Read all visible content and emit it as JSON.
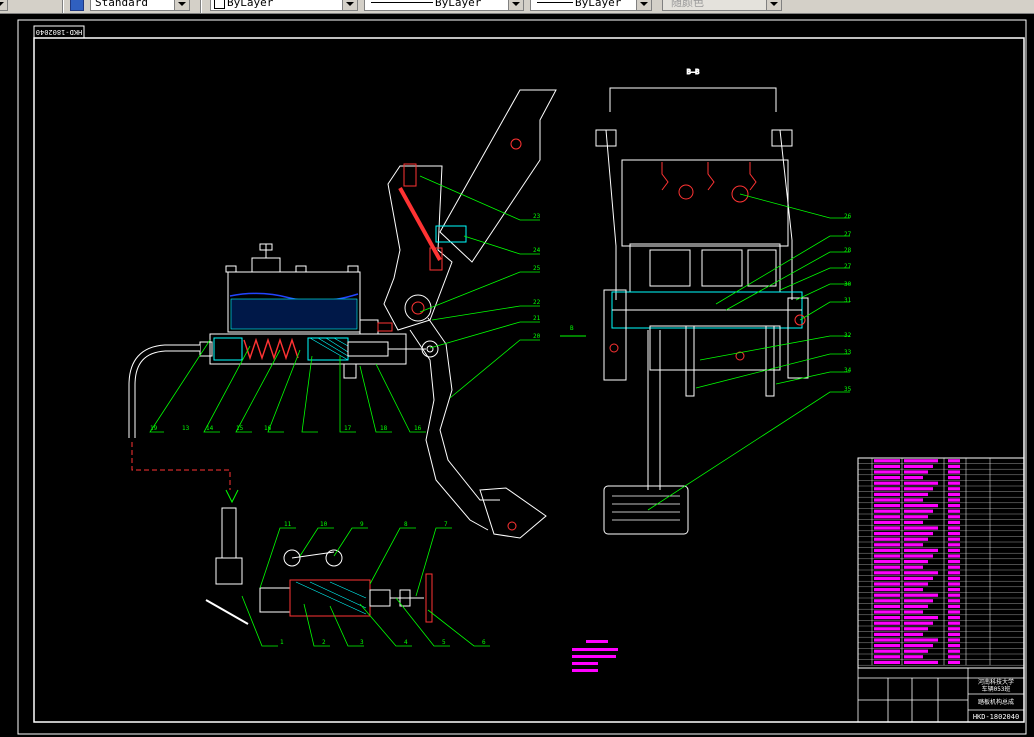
{
  "toolbar": {
    "textstyle_value": "Standard",
    "layer_value": "ByLayer",
    "linetype_value": "ByLayer",
    "lineweight_value": "ByLayer",
    "plotstyle_value": "随颜色"
  },
  "drawing": {
    "frame_code_rotated": "HKD-1802040",
    "section_label": "B—B",
    "view_arrow_label": "B",
    "title_block": {
      "school": "河南科技大学",
      "class_name": "车辆053班",
      "drawing_name": "踏板机构总成",
      "drawing_code": "HKD-1802040"
    },
    "callouts_main": [
      "23",
      "24",
      "25",
      "22",
      "21",
      "20",
      "19",
      "13",
      "14",
      "15",
      "16",
      "17",
      "18",
      "16"
    ],
    "callouts_section": [
      "26",
      "27",
      "28",
      "27",
      "30",
      "31",
      "32",
      "33",
      "34",
      "35"
    ],
    "callouts_bottom": [
      "11",
      "10",
      "9",
      "8",
      "7",
      "1",
      "2",
      "3",
      "4",
      "5",
      "6"
    ]
  },
  "colors": {
    "background": "#000000",
    "outline": "#ffffff",
    "leader": "#00ff00",
    "hatch": "#00ffff",
    "spring": "#ff3333",
    "fluid": "#2244ff",
    "bom": "#ff00ff",
    "note": "#ff00ff"
  }
}
